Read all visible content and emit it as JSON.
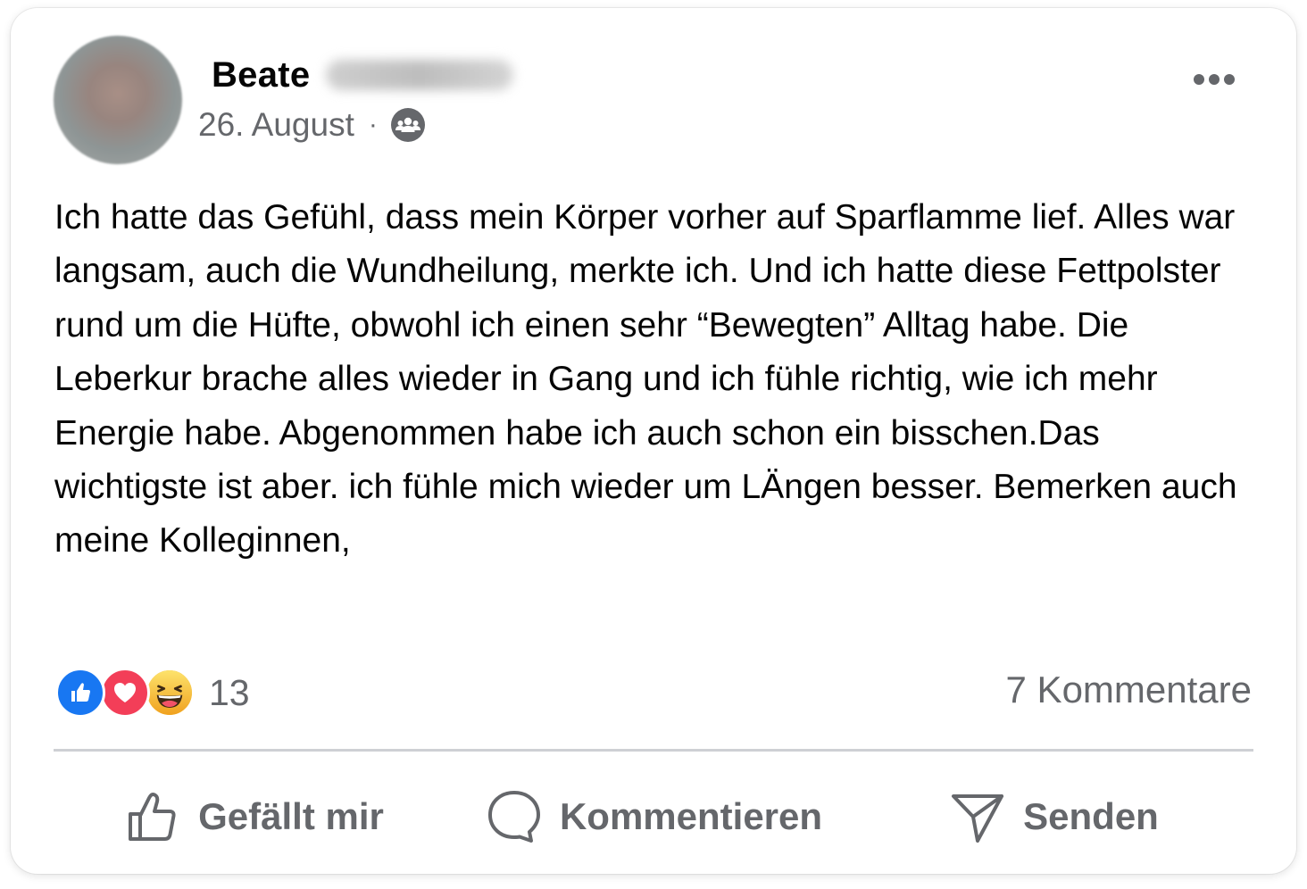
{
  "post": {
    "author_first_name": "Beate",
    "date": "26. August",
    "separator": "·",
    "audience_icon": "group-icon",
    "more_icon": "more-options-icon",
    "text": "Ich hatte das Gefühl, dass mein Körper vorher auf Sparflamme lief. Alles war langsam, auch die Wundheilung, merkte ich. Und ich hatte diese Fettpolster rund um die Hüfte, obwohl ich einen sehr “Bewegten” Alltag habe. Die Leberkur brache alles wieder in Gang und ich fühle richtig, wie ich mehr Energie habe. Abgenommen habe ich auch schon ein bisschen.Das wichtigste ist aber. ich fühle mich wieder um LÄngen besser. Bemerken auch meine Kolleginnen,"
  },
  "reactions": {
    "types": [
      "like",
      "love",
      "haha"
    ],
    "count": "13",
    "comments": "7 Kommentare"
  },
  "actions": {
    "like_label": "Gefällt mir",
    "comment_label": "Kommentieren",
    "send_label": "Senden"
  },
  "colors": {
    "text_primary": "#050505",
    "text_secondary": "#65676b",
    "like_blue": "#1877f2",
    "love_red": "#f33e58",
    "haha_yellow": "#f7b928",
    "divider": "#ced0d4"
  }
}
